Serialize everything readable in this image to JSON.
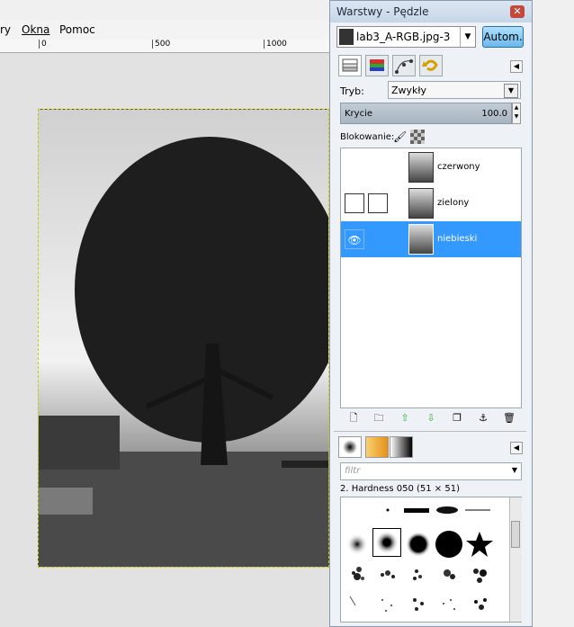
{
  "main_menu": [
    "ry",
    "Okna",
    "Pomoc"
  ],
  "ruler": {
    "ticks": [
      "0",
      "500",
      "1000"
    ]
  },
  "dock": {
    "title": "Warstwy - Pędzle",
    "close_glyph": "✕",
    "image_selector": "lab3_A-RGB.jpg-3",
    "auto_button": "Autom.",
    "tab_icons": [
      "layers-icon",
      "channels-icon",
      "paths-icon",
      "undo-history-icon"
    ],
    "mode_label": "Tryb:",
    "mode_value": "Zwykły",
    "opacity_label": "Krycie",
    "opacity_value": "100.0",
    "lock_label": "Blokowanie:",
    "layers": [
      {
        "name": "czerwony",
        "visible": false,
        "selected": false
      },
      {
        "name": "zielony",
        "visible": false,
        "selected": false
      },
      {
        "name": "niebieski",
        "visible": true,
        "selected": true
      }
    ],
    "layer_buttons": [
      "new-layer-icon",
      "new-group-icon",
      "raise-layer-icon",
      "lower-layer-icon",
      "duplicate-layer-icon",
      "anchor-layer-icon",
      "delete-layer-icon"
    ],
    "bottom_tab_icons": [
      "brushes-icon",
      "gradients-icon",
      "gradients-bw-icon"
    ],
    "filter_placeholder": "filtr",
    "brush_name": "2. Hardness 050 (51 × 51)"
  }
}
